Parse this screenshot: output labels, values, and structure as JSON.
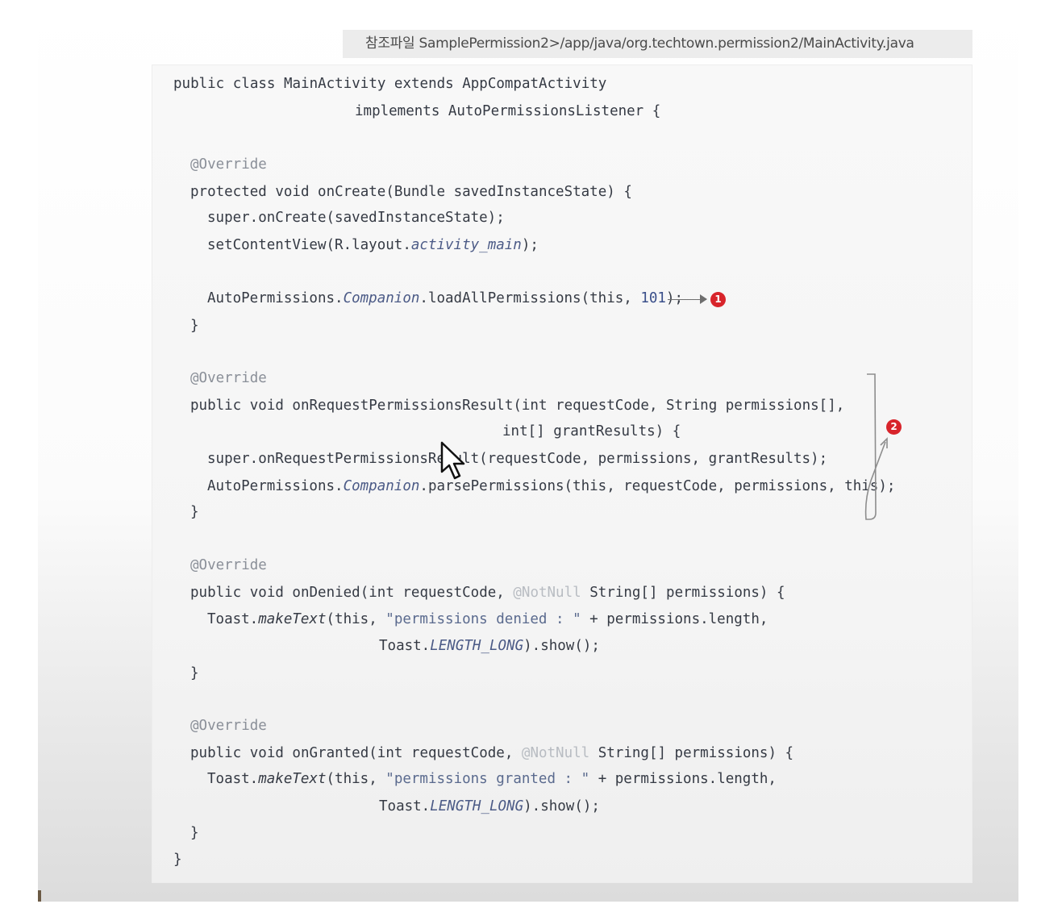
{
  "header": {
    "path": "참조파일 SamplePermission2>/app/java/org.techtown.permission2/MainActivity.java"
  },
  "code": {
    "class_decl": "public class MainActivity extends AppCompatActivity",
    "implements_line": "implements AutoPermissionsListener {",
    "override_1": "@Override",
    "oncreate_sig": "protected void onCreate(Bundle savedInstanceState) {",
    "oncreate_super": "super.onCreate(savedInstanceState);",
    "setcontent_a": "setContentView(R.layout.",
    "setcontent_b": "activity_main",
    "setcontent_c": ");",
    "load_a": "AutoPermissions.",
    "load_b": "Companion",
    "load_c": ".loadAllPermissions(this, ",
    "load_d": "101",
    "load_e": ");",
    "close_1": "}",
    "override_2": "@Override",
    "onreq_sig_1": "public void onRequestPermissionsResult(int requestCode, String permissions[],",
    "onreq_sig_2": "int[] grantResults) {",
    "onreq_super": "super.onRequestPermissionsResult(requestCode, permissions, grantResults);",
    "parse_a": "AutoPermissions.",
    "parse_b": "Companion",
    "parse_c": ".parsePermissions(this, requestCode, permissions, this);",
    "close_2": "}",
    "override_3": "@Override",
    "ondenied_a": "public void onDenied(int requestCode, ",
    "ondenied_b": "@NotNull",
    "ondenied_c": " String[] permissions) {",
    "toast1_a": "Toast.",
    "toast1_b": "makeText",
    "toast1_c": "(this, ",
    "toast1_d": "\"permissions denied : \"",
    "toast1_e": " + permissions.length,",
    "toast1l2_a": "Toast.",
    "toast1l2_b": "LENGTH_LONG",
    "toast1l2_c": ").show();",
    "close_3": "}",
    "override_4": "@Override",
    "ongranted_a": "public void onGranted(int requestCode, ",
    "ongranted_b": "@NotNull",
    "ongranted_c": " String[] permissions) {",
    "toast2_a": "Toast.",
    "toast2_b": "makeText",
    "toast2_c": "(this, ",
    "toast2_d": "\"permissions granted : \"",
    "toast2_e": " + permissions.length,",
    "toast2l2_a": "Toast.",
    "toast2l2_b": "LENGTH_LONG",
    "toast2l2_c": ").show();",
    "close_4": "}",
    "close_class": "}"
  },
  "annotations": {
    "badge_1": "1",
    "badge_2": "2",
    "badge_color": "#d8242b"
  },
  "icons": {
    "cursor": "mouse-pointer-icon",
    "arrow": "right-arrow-icon"
  }
}
